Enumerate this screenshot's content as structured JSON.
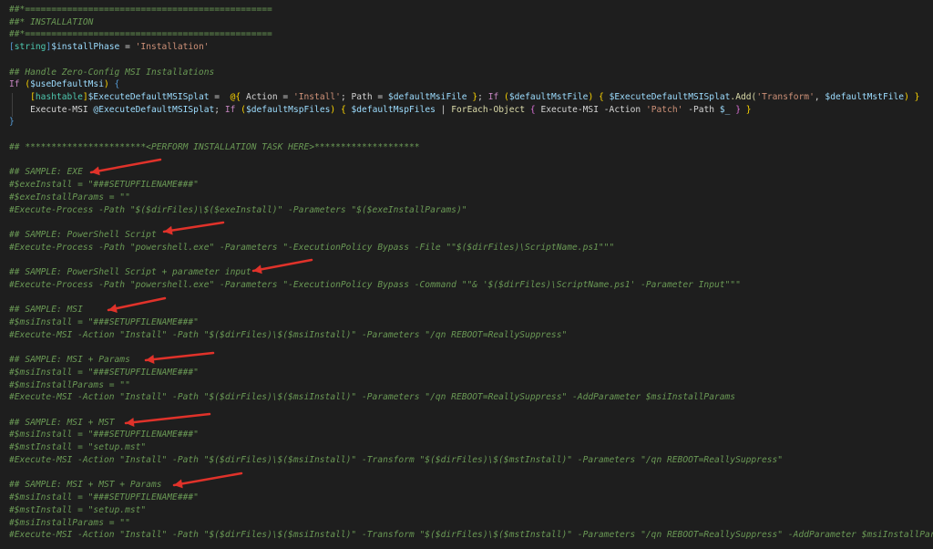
{
  "editor": {
    "colors": {
      "background": "#1e1e1e",
      "comment": "#6a9955",
      "variable": "#9cdcfe",
      "keyword": "#c586c0",
      "function": "#dcdcaa",
      "string": "#ce9178",
      "type": "#4ec9b0",
      "bracket": "#569cd6",
      "annotation_arrow": "#e0322a"
    },
    "lines": [
      {
        "tokens": [
          {
            "t": "##*===============================================",
            "c": "com"
          }
        ]
      },
      {
        "tokens": [
          {
            "t": "##* INSTALLATION",
            "c": "com"
          }
        ]
      },
      {
        "tokens": [
          {
            "t": "##*===============================================",
            "c": "com"
          }
        ]
      },
      {
        "tokens": [
          {
            "t": "[",
            "c": "brk"
          },
          {
            "t": "string",
            "c": "type"
          },
          {
            "t": "]",
            "c": "brk"
          },
          {
            "t": "$installPhase",
            "c": "var"
          },
          {
            "t": " = ",
            "c": "txt"
          },
          {
            "t": "'Installation'",
            "c": "str"
          }
        ]
      },
      {
        "tokens": []
      },
      {
        "tokens": [
          {
            "t": "## Handle Zero-Config MSI Installations",
            "c": "com"
          }
        ]
      },
      {
        "tokens": [
          {
            "t": "If",
            "c": "kw"
          },
          {
            "t": " (",
            "c": "brk2"
          },
          {
            "t": "$useDefaultMsi",
            "c": "var"
          },
          {
            "t": ")",
            "c": "brk2"
          },
          {
            "t": " {",
            "c": "brk"
          }
        ]
      },
      {
        "tokens": [
          {
            "t": "    [",
            "c": "brk2"
          },
          {
            "t": "hashtable",
            "c": "type"
          },
          {
            "t": "]",
            "c": "brk2"
          },
          {
            "t": "$ExecuteDefaultMSISplat",
            "c": "var"
          },
          {
            "t": " =  ",
            "c": "txt"
          },
          {
            "t": "@{",
            "c": "brk2"
          },
          {
            "t": " Action = ",
            "c": "txt"
          },
          {
            "t": "'Install'",
            "c": "str"
          },
          {
            "t": "; Path = ",
            "c": "txt"
          },
          {
            "t": "$defaultMsiFile",
            "c": "var"
          },
          {
            "t": " }",
            "c": "brk2"
          },
          {
            "t": "; ",
            "c": "txt"
          },
          {
            "t": "If",
            "c": "kw"
          },
          {
            "t": " (",
            "c": "brk2"
          },
          {
            "t": "$defaultMstFile",
            "c": "var"
          },
          {
            "t": ")",
            "c": "brk2"
          },
          {
            "t": " { ",
            "c": "brk2"
          },
          {
            "t": "$ExecuteDefaultMSISplat",
            "c": "var"
          },
          {
            "t": ".Add(",
            "c": "fn"
          },
          {
            "t": "'Transform'",
            "c": "str"
          },
          {
            "t": ", ",
            "c": "txt"
          },
          {
            "t": "$defaultMstFile",
            "c": "var"
          },
          {
            "t": ") }",
            "c": "brk2"
          }
        ]
      },
      {
        "tokens": [
          {
            "t": "    Execute-MSI ",
            "c": "txt"
          },
          {
            "t": "@ExecuteDefaultMSISplat",
            "c": "var"
          },
          {
            "t": "; ",
            "c": "txt"
          },
          {
            "t": "If",
            "c": "kw"
          },
          {
            "t": " (",
            "c": "brk2"
          },
          {
            "t": "$defaultMspFiles",
            "c": "var"
          },
          {
            "t": ")",
            "c": "brk2"
          },
          {
            "t": " { ",
            "c": "brk2"
          },
          {
            "t": "$defaultMspFiles",
            "c": "var"
          },
          {
            "t": " | ",
            "c": "txt"
          },
          {
            "t": "ForEach-Object",
            "c": "fn"
          },
          {
            "t": " { ",
            "c": "brk3"
          },
          {
            "t": "Execute-MSI -Action ",
            "c": "txt"
          },
          {
            "t": "'Patch'",
            "c": "str"
          },
          {
            "t": " -Path ",
            "c": "txt"
          },
          {
            "t": "$_",
            "c": "var"
          },
          {
            "t": " }",
            "c": "brk3"
          },
          {
            "t": " }",
            "c": "brk2"
          }
        ]
      },
      {
        "tokens": [
          {
            "t": "}",
            "c": "brk"
          }
        ]
      },
      {
        "tokens": []
      },
      {
        "tokens": [
          {
            "t": "## ***********************<PERFORM INSTALLATION TASK HERE>********************",
            "c": "com"
          }
        ]
      },
      {
        "tokens": []
      },
      {
        "tokens": [
          {
            "t": "## SAMPLE: EXE",
            "c": "com"
          }
        ]
      },
      {
        "tokens": [
          {
            "t": "#$exeInstall = \"###SETUPFILENAME###\"",
            "c": "com"
          }
        ]
      },
      {
        "tokens": [
          {
            "t": "#$exeInstallParams = \"\"",
            "c": "com"
          }
        ]
      },
      {
        "tokens": [
          {
            "t": "#Execute-Process -Path \"$($dirFiles)\\$($exeInstall)\" -Parameters \"$($exeInstallParams)\"",
            "c": "com"
          }
        ]
      },
      {
        "tokens": []
      },
      {
        "tokens": [
          {
            "t": "## SAMPLE: PowerShell Script",
            "c": "com"
          }
        ]
      },
      {
        "tokens": [
          {
            "t": "#Execute-Process -Path \"powershell.exe\" -Parameters \"-ExecutionPolicy Bypass -File \"\"$($dirFiles)\\ScriptName.ps1\"\"\"",
            "c": "com"
          }
        ]
      },
      {
        "tokens": []
      },
      {
        "tokens": [
          {
            "t": "## SAMPLE: PowerShell Script + parameter input",
            "c": "com"
          }
        ]
      },
      {
        "tokens": [
          {
            "t": "#Execute-Process -Path \"powershell.exe\" -Parameters \"-ExecutionPolicy Bypass -Command \"\"& '$($dirFiles)\\ScriptName.ps1' -Parameter Input\"\"\"",
            "c": "com"
          }
        ]
      },
      {
        "tokens": []
      },
      {
        "tokens": [
          {
            "t": "## SAMPLE: MSI",
            "c": "com"
          }
        ]
      },
      {
        "tokens": [
          {
            "t": "#$msiInstall = \"###SETUPFILENAME###\"",
            "c": "com"
          }
        ]
      },
      {
        "tokens": [
          {
            "t": "#Execute-MSI -Action \"Install\" -Path \"$($dirFiles)\\$($msiInstall)\" -Parameters \"/qn REBOOT=ReallySuppress\"",
            "c": "com"
          }
        ]
      },
      {
        "tokens": []
      },
      {
        "tokens": [
          {
            "t": "## SAMPLE: MSI + Params",
            "c": "com"
          }
        ]
      },
      {
        "tokens": [
          {
            "t": "#$msiInstall = \"###SETUPFILENAME###\"",
            "c": "com"
          }
        ]
      },
      {
        "tokens": [
          {
            "t": "#$msiInstallParams = \"\"",
            "c": "com"
          }
        ]
      },
      {
        "tokens": [
          {
            "t": "#Execute-MSI -Action \"Install\" -Path \"$($dirFiles)\\$($msiInstall)\" -Parameters \"/qn REBOOT=ReallySuppress\" -AddParameter $msiInstallParams",
            "c": "com"
          }
        ]
      },
      {
        "tokens": []
      },
      {
        "tokens": [
          {
            "t": "## SAMPLE: MSI + MST",
            "c": "com"
          }
        ]
      },
      {
        "tokens": [
          {
            "t": "#$msiInstall = \"###SETUPFILENAME###\"",
            "c": "com"
          }
        ]
      },
      {
        "tokens": [
          {
            "t": "#$mstInstall = \"setup.mst\"",
            "c": "com"
          }
        ]
      },
      {
        "tokens": [
          {
            "t": "#Execute-MSI -Action \"Install\" -Path \"$($dirFiles)\\$($msiInstall)\" -Transform \"$($dirFiles)\\$($mstInstall)\" -Parameters \"/qn REBOOT=ReallySuppress\"",
            "c": "com"
          }
        ]
      },
      {
        "tokens": []
      },
      {
        "tokens": [
          {
            "t": "## SAMPLE: MSI + MST + Params",
            "c": "com"
          }
        ]
      },
      {
        "tokens": [
          {
            "t": "#$msiInstall = \"###SETUPFILENAME###\"",
            "c": "com"
          }
        ]
      },
      {
        "tokens": [
          {
            "t": "#$mstInstall = \"setup.mst\"",
            "c": "com"
          }
        ]
      },
      {
        "tokens": [
          {
            "t": "#$msiInstallParams = \"\"",
            "c": "com"
          }
        ]
      },
      {
        "tokens": [
          {
            "t": "#Execute-MSI -Action \"Install\" -Path \"$($dirFiles)\\$($msiInstall)\" -Transform \"$($dirFiles)\\$($mstInstall)\" -Parameters \"/qn REBOOT=ReallySuppress\" -AddParameter $msiInstallParams",
            "c": "com"
          }
        ]
      }
    ]
  }
}
